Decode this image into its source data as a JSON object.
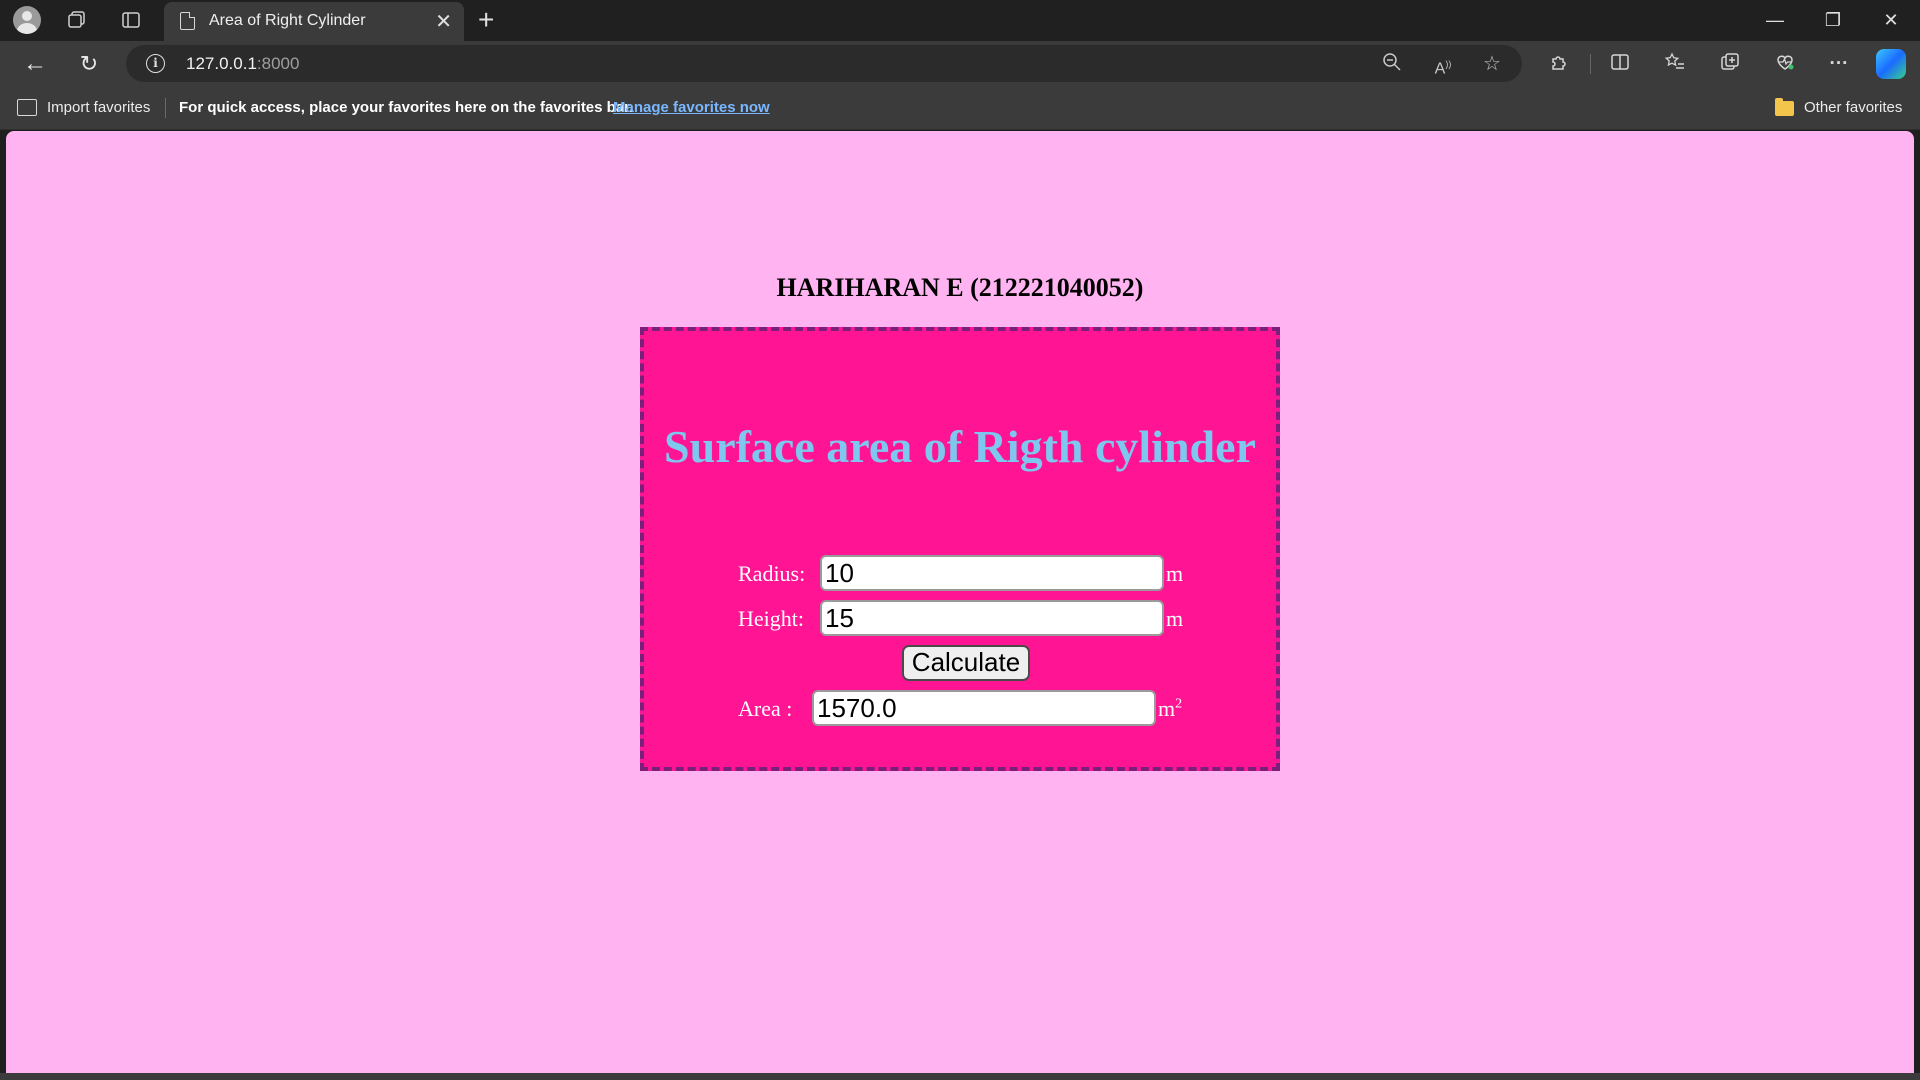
{
  "browser": {
    "tab_title": "Area of Right Cylinder",
    "url_host": "127.0.0.1",
    "url_port": ":8000",
    "favorites_bar": {
      "import_label": "Import favorites",
      "hint": "For quick access, place your favorites here on the favorites bar.",
      "manage_link": "Manage favorites now",
      "other_favorites": "Other favorites"
    }
  },
  "page": {
    "student": "HARIHARAN E (212221040052)",
    "title": "Surface area of Rigth cylinder",
    "radius_label": "Radius:",
    "radius_value": "10",
    "radius_unit": "m",
    "height_label": "Height:",
    "height_value": "15",
    "height_unit": "m",
    "calculate_label": "Calculate",
    "area_label": "Area :",
    "area_value": "1570.0",
    "area_unit": "m",
    "area_unit_sup": "2",
    "colors": {
      "page_background": "#ffb3f1",
      "card_background": "#ff1493",
      "card_border": "#7a1f7a",
      "title": "#7ec8ef"
    }
  }
}
